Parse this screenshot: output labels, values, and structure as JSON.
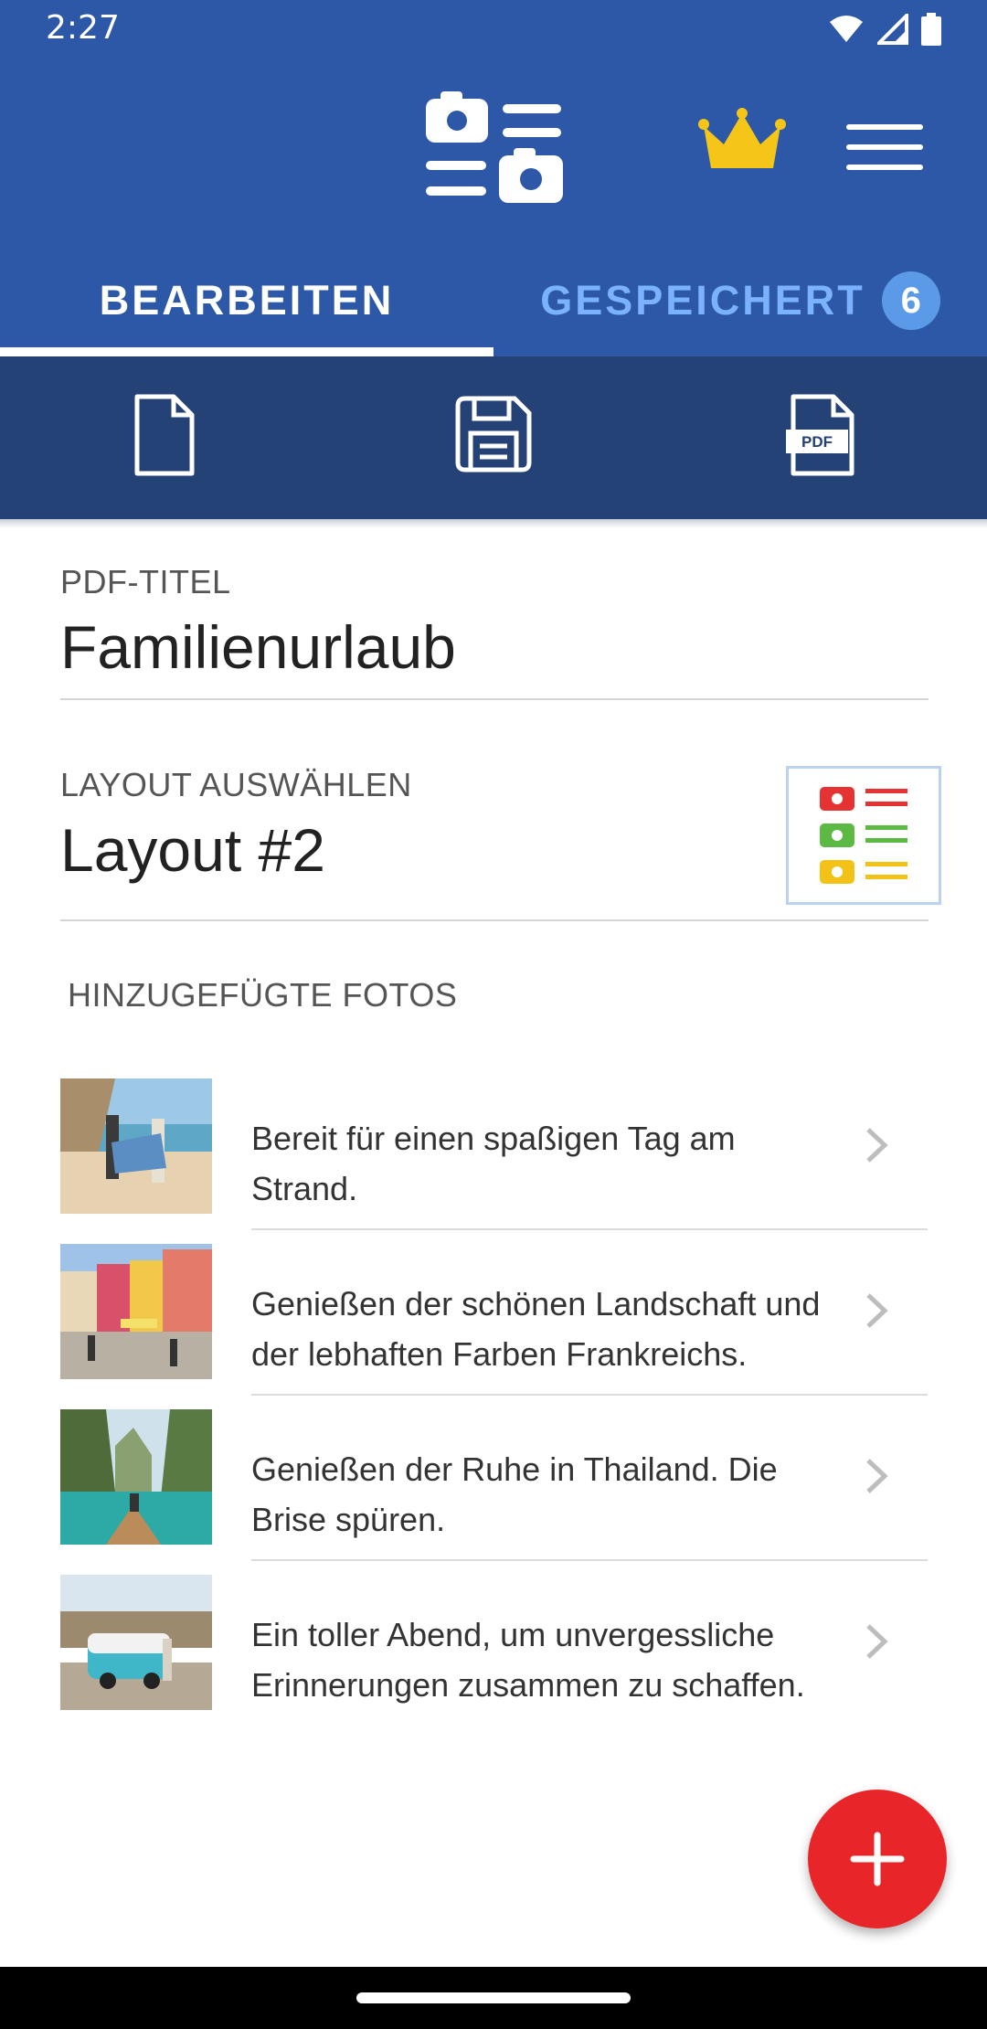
{
  "status": {
    "time": "2:27"
  },
  "header": {
    "logo_icon": "photo-list-icon",
    "premium_icon": "crown-icon",
    "menu_icon": "hamburger-menu-icon"
  },
  "tabs": [
    {
      "label": "BEARBEITEN",
      "selected": true
    },
    {
      "label": "GESPEICHERT",
      "count": "6",
      "selected": false
    }
  ],
  "toolbar": {
    "items": [
      "new-document-icon",
      "save-icon",
      "pdf-icon"
    ]
  },
  "pdf_title": {
    "label": "PDF-TITEL",
    "value": "Familienurlaub"
  },
  "layout": {
    "label": "LAYOUT AUSWÄHLEN",
    "value": "Layout #2"
  },
  "photos": {
    "label": "HINZUGEFÜGTE FOTOS",
    "items": [
      {
        "caption": "Bereit für einen spaßigen Tag am Strand."
      },
      {
        "caption": "Genießen der schönen Landschaft und der lebhaften Farben Frankreichs."
      },
      {
        "caption": "Genießen der Ruhe in Thailand. Die Brise spüren."
      },
      {
        "caption": "Ein toller Abend, um unvergessliche Erinnerungen zusammen zu schaffen."
      }
    ]
  },
  "fab": {
    "icon": "plus-icon"
  },
  "colors": {
    "appbar": "#2d58a8",
    "toolbar": "#254276",
    "fab": "#e8262a",
    "crown": "#f5c518"
  }
}
